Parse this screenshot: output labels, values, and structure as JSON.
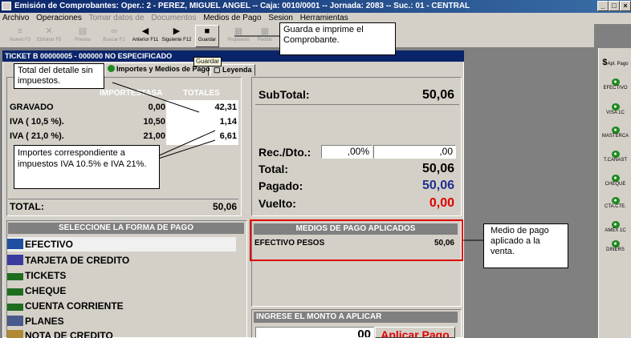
{
  "window": {
    "title": "Emisión de Comprobantes: Oper.: 2 - PEREZ, MIGUEL ANGEL  --  Caja: 0010/0001  --  Jornada: 2083  --  Suc.: 01 - CENTRAL"
  },
  "menu": [
    {
      "label": "Archivo",
      "enabled": true
    },
    {
      "label": "Operaciones",
      "enabled": true
    },
    {
      "label": "Tomar datos de",
      "enabled": false
    },
    {
      "label": "Documentos",
      "enabled": false
    },
    {
      "label": "Medios de Pago",
      "enabled": true
    },
    {
      "label": "Sesion",
      "enabled": true
    },
    {
      "label": "Herramientas",
      "enabled": true
    }
  ],
  "toolbar": {
    "nuevo": "Nuevo F3",
    "eliminar": "Eliminar F5",
    "preview": "Previsu",
    "buscar": "Buscar F2",
    "anterior": "Anterior F11",
    "siguiente": "Siguiente F12",
    "guardar": "Guardar",
    "disabled1": "Propuesto",
    "disabled2": "Pedido"
  },
  "tooltip": "Guardar",
  "form": {
    "title": "TICKET  B  00000005  -  000000  NO ESPECIFICADO",
    "tabs": [
      "Importes y Medios de Pago",
      "Leyenda"
    ],
    "taxes": {
      "headers": [
        "IMPORTES",
        "TASA",
        "TOTALES"
      ],
      "rows": [
        {
          "label": "GRAVADO",
          "rate": "0,00",
          "total": "42,31"
        },
        {
          "label": "IVA  ( 10,5 %).",
          "rate": "10,50",
          "total": "1,14"
        },
        {
          "label": "IVA  ( 21,0 %).",
          "rate": "21,00",
          "total": "6,61"
        }
      ],
      "total_label": "TOTAL:",
      "total_value": "50,06"
    },
    "summary": {
      "subtotal_label": "SubTotal:",
      "subtotal_value": "50,06",
      "recdto_label": "Rec./Dto.:",
      "recdto_pct": ",00%",
      "recdto_amount": ",00",
      "total_label": "Total:",
      "total_value": "50,06",
      "pagado_label": "Pagado:",
      "pagado_value": "50,06",
      "vuelto_label": "Vuelto:",
      "vuelto_value": "0,00"
    },
    "payment_select_header": "SELECCIONE LA FORMA DE PAGO",
    "payment_methods": [
      "EFECTIVO",
      "TARJETA DE CREDITO",
      "TICKETS",
      "CHEQUE",
      "CUENTA CORRIENTE",
      "PLANES",
      "NOTA DE CREDITO"
    ],
    "applied_header": "MEDIOS DE PAGO APLICADOS",
    "applied": [
      {
        "name": "EFECTIVO PESOS",
        "amount": "50,06"
      }
    ],
    "amount_header": "INGRESE EL MONTO A APLICAR",
    "amount_value": "00",
    "apply_button": "Aplicar Pago"
  },
  "right_panel": [
    {
      "label": "Apl. Pago",
      "icon": "dollar-icon"
    },
    {
      "label": "EFECTIVO",
      "icon": "money-icon"
    },
    {
      "label": "VISA 1C",
      "icon": "money-icon"
    },
    {
      "label": "MASTERCA",
      "icon": "money-icon"
    },
    {
      "label": "T.CANAST",
      "icon": "money-icon"
    },
    {
      "label": "CHEQUE",
      "icon": "money-icon"
    },
    {
      "label": "CTA.CTE.",
      "icon": "money-icon"
    },
    {
      "label": "AMEX 1C",
      "icon": "money-icon"
    },
    {
      "label": "DINERS",
      "icon": "money-icon"
    }
  ],
  "callouts": {
    "save": "Guarda e imprime el Comprobante.",
    "subtotal": "Total del detalle sin impuestos.",
    "taxes": "Importes correspondiente a impuestos IVA 10.5% e IVA 21%.",
    "applied": "Medio de pago aplicado a la venta."
  },
  "colors": {
    "title_bar": "#0a246a",
    "pagado": "#1f2f8f",
    "vuelto": "#e00000",
    "highlight": "#e00000"
  }
}
